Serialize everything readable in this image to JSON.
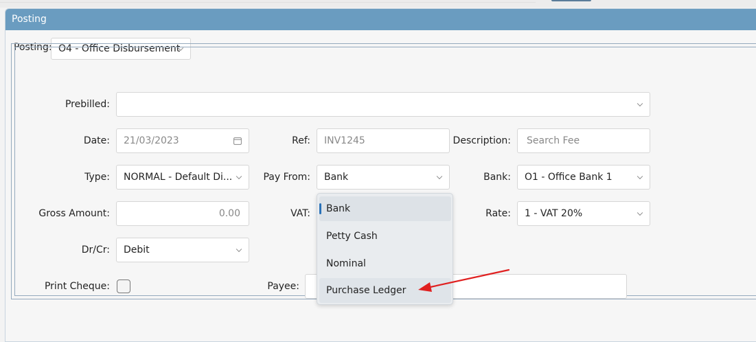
{
  "panel": {
    "title": "Posting"
  },
  "posting": {
    "label": "Posting:",
    "value": "O4 - Office Disbursement"
  },
  "form": {
    "prebilled": {
      "label": "Prebilled:",
      "value": ""
    },
    "date": {
      "label": "Date:",
      "value": "21/03/2023"
    },
    "ref": {
      "label": "Ref:",
      "value": "INV1245"
    },
    "description": {
      "label": "Description:",
      "placeholder": "Search Fee"
    },
    "type": {
      "label": "Type:",
      "value": "NORMAL - Default Di..."
    },
    "pay_from": {
      "label": "Pay From:",
      "value": "Bank"
    },
    "bank": {
      "label": "Bank:",
      "value": "O1 - Office Bank 1"
    },
    "gross_amount": {
      "label": "Gross Amount:",
      "value": "0.00"
    },
    "vat": {
      "label": "VAT:"
    },
    "rate": {
      "label": "Rate:",
      "value": "1 - VAT 20%"
    },
    "dr_cr": {
      "label": "Dr/Cr:",
      "value": "Debit"
    },
    "print_cheque": {
      "label": "Print Cheque:",
      "checked": false
    },
    "payee": {
      "label": "Payee:",
      "value": ""
    }
  },
  "pay_from_dropdown": {
    "options": [
      "Bank",
      "Petty Cash",
      "Nominal",
      "Purchase Ledger"
    ],
    "selected": "Bank",
    "highlighted": "Purchase Ledger"
  },
  "colors": {
    "header": "#6a9cc0",
    "accent": "#2a72b8",
    "annotation_arrow": "#e02020"
  }
}
